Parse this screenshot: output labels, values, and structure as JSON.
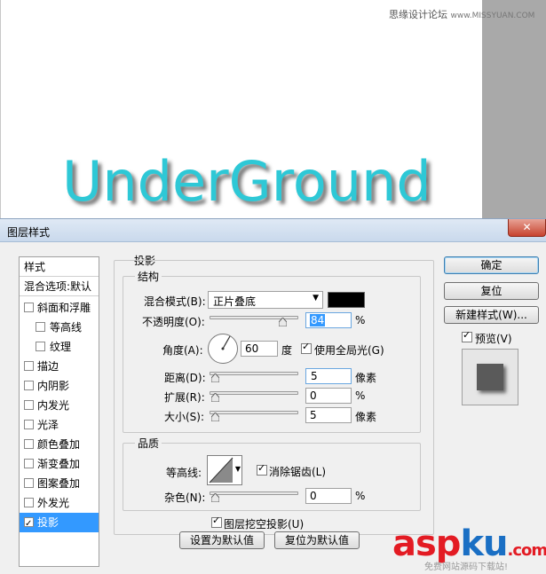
{
  "watermark_top": {
    "text": "思缘设计论坛",
    "site": "www.MISSYUAN.COM"
  },
  "canvas_text": "UnderGround",
  "dialog": {
    "title": "图层样式",
    "close_label": "✕"
  },
  "style_list": {
    "header": "样式",
    "blend_options": "混合选项:默认",
    "items": [
      {
        "label": "斜面和浮雕",
        "checked": false,
        "indent": false
      },
      {
        "label": "等高线",
        "checked": false,
        "indent": true
      },
      {
        "label": "纹理",
        "checked": false,
        "indent": true
      },
      {
        "label": "描边",
        "checked": false,
        "indent": false
      },
      {
        "label": "内阴影",
        "checked": false,
        "indent": false
      },
      {
        "label": "内发光",
        "checked": false,
        "indent": false
      },
      {
        "label": "光泽",
        "checked": false,
        "indent": false
      },
      {
        "label": "颜色叠加",
        "checked": false,
        "indent": false
      },
      {
        "label": "渐变叠加",
        "checked": false,
        "indent": false
      },
      {
        "label": "图案叠加",
        "checked": false,
        "indent": false
      },
      {
        "label": "外发光",
        "checked": false,
        "indent": false
      },
      {
        "label": "投影",
        "checked": true,
        "indent": false,
        "selected": true
      }
    ]
  },
  "panel": {
    "section_title": "投影",
    "structure": {
      "label": "结构",
      "blend_mode_label": "混合模式(B):",
      "blend_mode_value": "正片叠底",
      "shadow_color": "#000000",
      "opacity_label": "不透明度(O):",
      "opacity_value": "84",
      "percent": "%",
      "angle_label": "角度(A):",
      "angle_value": "60",
      "degree_unit": "度",
      "global_light_label": "使用全局光(G)",
      "global_light_checked": true,
      "distance_label": "距离(D):",
      "distance_value": "5",
      "px_unit": "像素",
      "spread_label": "扩展(R):",
      "spread_value": "0",
      "size_label": "大小(S):",
      "size_value": "5"
    },
    "quality": {
      "label": "品质",
      "contour_label": "等高线:",
      "antialias_label": "消除锯齿(L)",
      "antialias_checked": true,
      "noise_label": "杂色(N):",
      "noise_value": "0",
      "percent": "%"
    },
    "knockout_label": "图层挖空投影(U)",
    "knockout_checked": true,
    "make_default_label": "设置为默认值",
    "reset_default_label": "复位为默认值"
  },
  "buttons": {
    "ok": "确定",
    "reset": "复位",
    "new_style": "新建样式(W)...",
    "preview_label": "预览(V)",
    "preview_checked": true
  },
  "asp_watermark": {
    "asp": "asp",
    "ku": "ku",
    "domain": ".com",
    "sub": "免费网站源码下载站!"
  },
  "colors": {
    "accent": "#3399ff",
    "text_cyan": "#2ec8d6"
  }
}
